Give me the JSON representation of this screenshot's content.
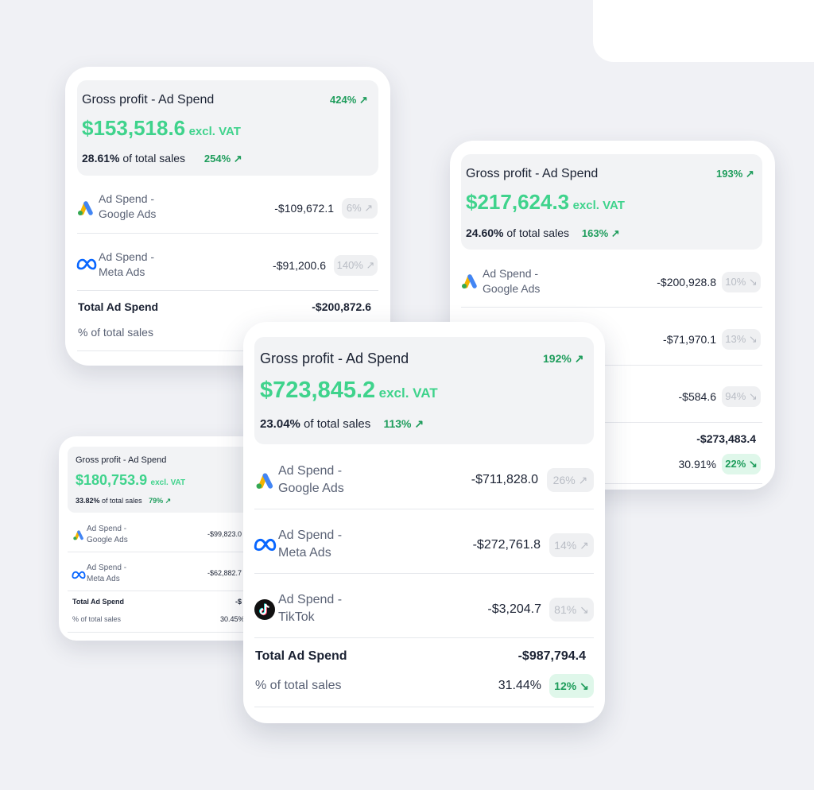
{
  "colors": {
    "accent_green": "#3fd38c",
    "pct_green": "#1f9d5c",
    "background": "#f0f1f5"
  },
  "card_a": {
    "title": "Gross profit - Ad Spend",
    "change": "424% ↗",
    "amount": "$153,518.6",
    "unit": "excl. VAT",
    "share": "28.61%",
    "share_label": "of total sales",
    "share_change": "254% ↗",
    "rows": [
      {
        "icon": "google-ads-icon",
        "label1": "Ad Spend -",
        "label2": "Google Ads",
        "value": "-$109,672.1",
        "badge": "6% ↗"
      },
      {
        "icon": "meta-icon",
        "label1": "Ad Spend -",
        "label2": "Meta Ads",
        "value": "-$91,200.6",
        "badge": "140% ↗"
      }
    ],
    "total_label": "Total Ad Spend",
    "total_value": "-$200,872.6",
    "pct_label": "% of total sales"
  },
  "card_b": {
    "title": "Gross profit - Ad Spend",
    "change": "193% ↗",
    "amount": "$217,624.3",
    "unit": "excl. VAT",
    "share": "24.60%",
    "share_label": "of total sales",
    "share_change": "163% ↗",
    "rows": [
      {
        "icon": "google-ads-icon",
        "label1": "Ad Spend -",
        "label2": "Google Ads",
        "value": "-$200,928.8",
        "badge": "10% ↘"
      },
      {
        "value": "-$71,970.1",
        "badge": "13% ↘"
      },
      {
        "value": "-$584.6",
        "badge": "94% ↘"
      }
    ],
    "total_value": "-$273,483.4",
    "pct_value": "30.91%",
    "pct_badge": "22% ↘"
  },
  "card_c": {
    "title": "Gross profit - Ad Spend",
    "amount": "$180,753.9",
    "unit": "excl. VAT",
    "share": "33.82%",
    "share_label": "of total sales",
    "share_change": "79% ↗",
    "rows": [
      {
        "icon": "google-ads-icon",
        "label1": "Ad Spend -",
        "label2": "Google Ads",
        "value": "-$99,823.0"
      },
      {
        "icon": "meta-icon",
        "label1": "Ad Spend -",
        "label2": "Meta Ads",
        "value": "-$62,882.7"
      }
    ],
    "total_label": "Total Ad Spend",
    "total_value": "-$",
    "pct_label": "% of total sales",
    "pct_value": "30.45%"
  },
  "card_d": {
    "title": "Gross profit - Ad Spend",
    "change": "192% ↗",
    "amount": "$723,845.2",
    "unit": "excl. VAT",
    "share": "23.04%",
    "share_label": "of total sales",
    "share_change": "113% ↗",
    "rows": [
      {
        "icon": "google-ads-icon",
        "label1": "Ad Spend -",
        "label2": "Google Ads",
        "value": "-$711,828.0",
        "badge": "26% ↗"
      },
      {
        "icon": "meta-icon",
        "label1": "Ad Spend -",
        "label2": "Meta Ads",
        "value": "-$272,761.8",
        "badge": "14% ↗"
      },
      {
        "icon": "tiktok-icon",
        "label1": "Ad Spend -",
        "label2": "TikTok",
        "value": "-$3,204.7",
        "badge": "81% ↘"
      }
    ],
    "total_label": "Total Ad Spend",
    "total_value": "-$987,794.4",
    "pct_label": "% of total sales",
    "pct_value": "31.44%",
    "pct_badge": "12% ↘"
  }
}
